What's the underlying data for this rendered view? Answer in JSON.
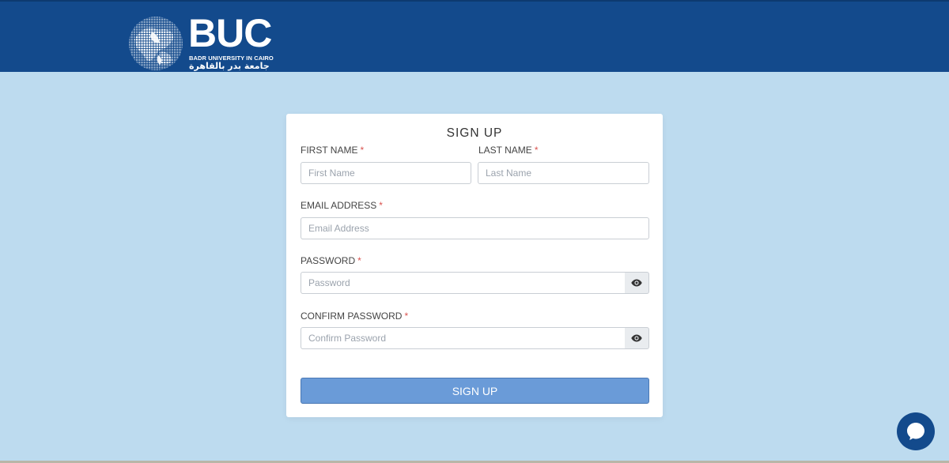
{
  "header": {
    "brand_name": "BUC",
    "brand_subtitle": "BADR UNIVERSITY IN CAIRO",
    "brand_arabic": "جامعة بدر بالقاهرة",
    "bg_color": "#134a8c"
  },
  "form": {
    "title": "SIGN UP",
    "required_mark": "*",
    "first_name": {
      "label": "FIRST NAME",
      "placeholder": "First Name",
      "value": ""
    },
    "last_name": {
      "label": "LAST NAME",
      "placeholder": "Last Name",
      "value": ""
    },
    "email": {
      "label": "EMAIL ADDRESS",
      "placeholder": "Email Address",
      "value": ""
    },
    "password": {
      "label": "PASSWORD",
      "placeholder": "Password",
      "value": "",
      "toggle_icon": "eye-icon"
    },
    "confirm_password": {
      "label": "CONFIRM PASSWORD",
      "placeholder": "Confirm Password",
      "value": "",
      "toggle_icon": "eye-icon"
    },
    "submit_label": "SIGN UP",
    "submit_color": "#6a9bd8"
  },
  "chat_widget": {
    "icon": "chat-bubble-icon",
    "color": "#134a8c"
  },
  "page": {
    "background": "#bddbef"
  }
}
